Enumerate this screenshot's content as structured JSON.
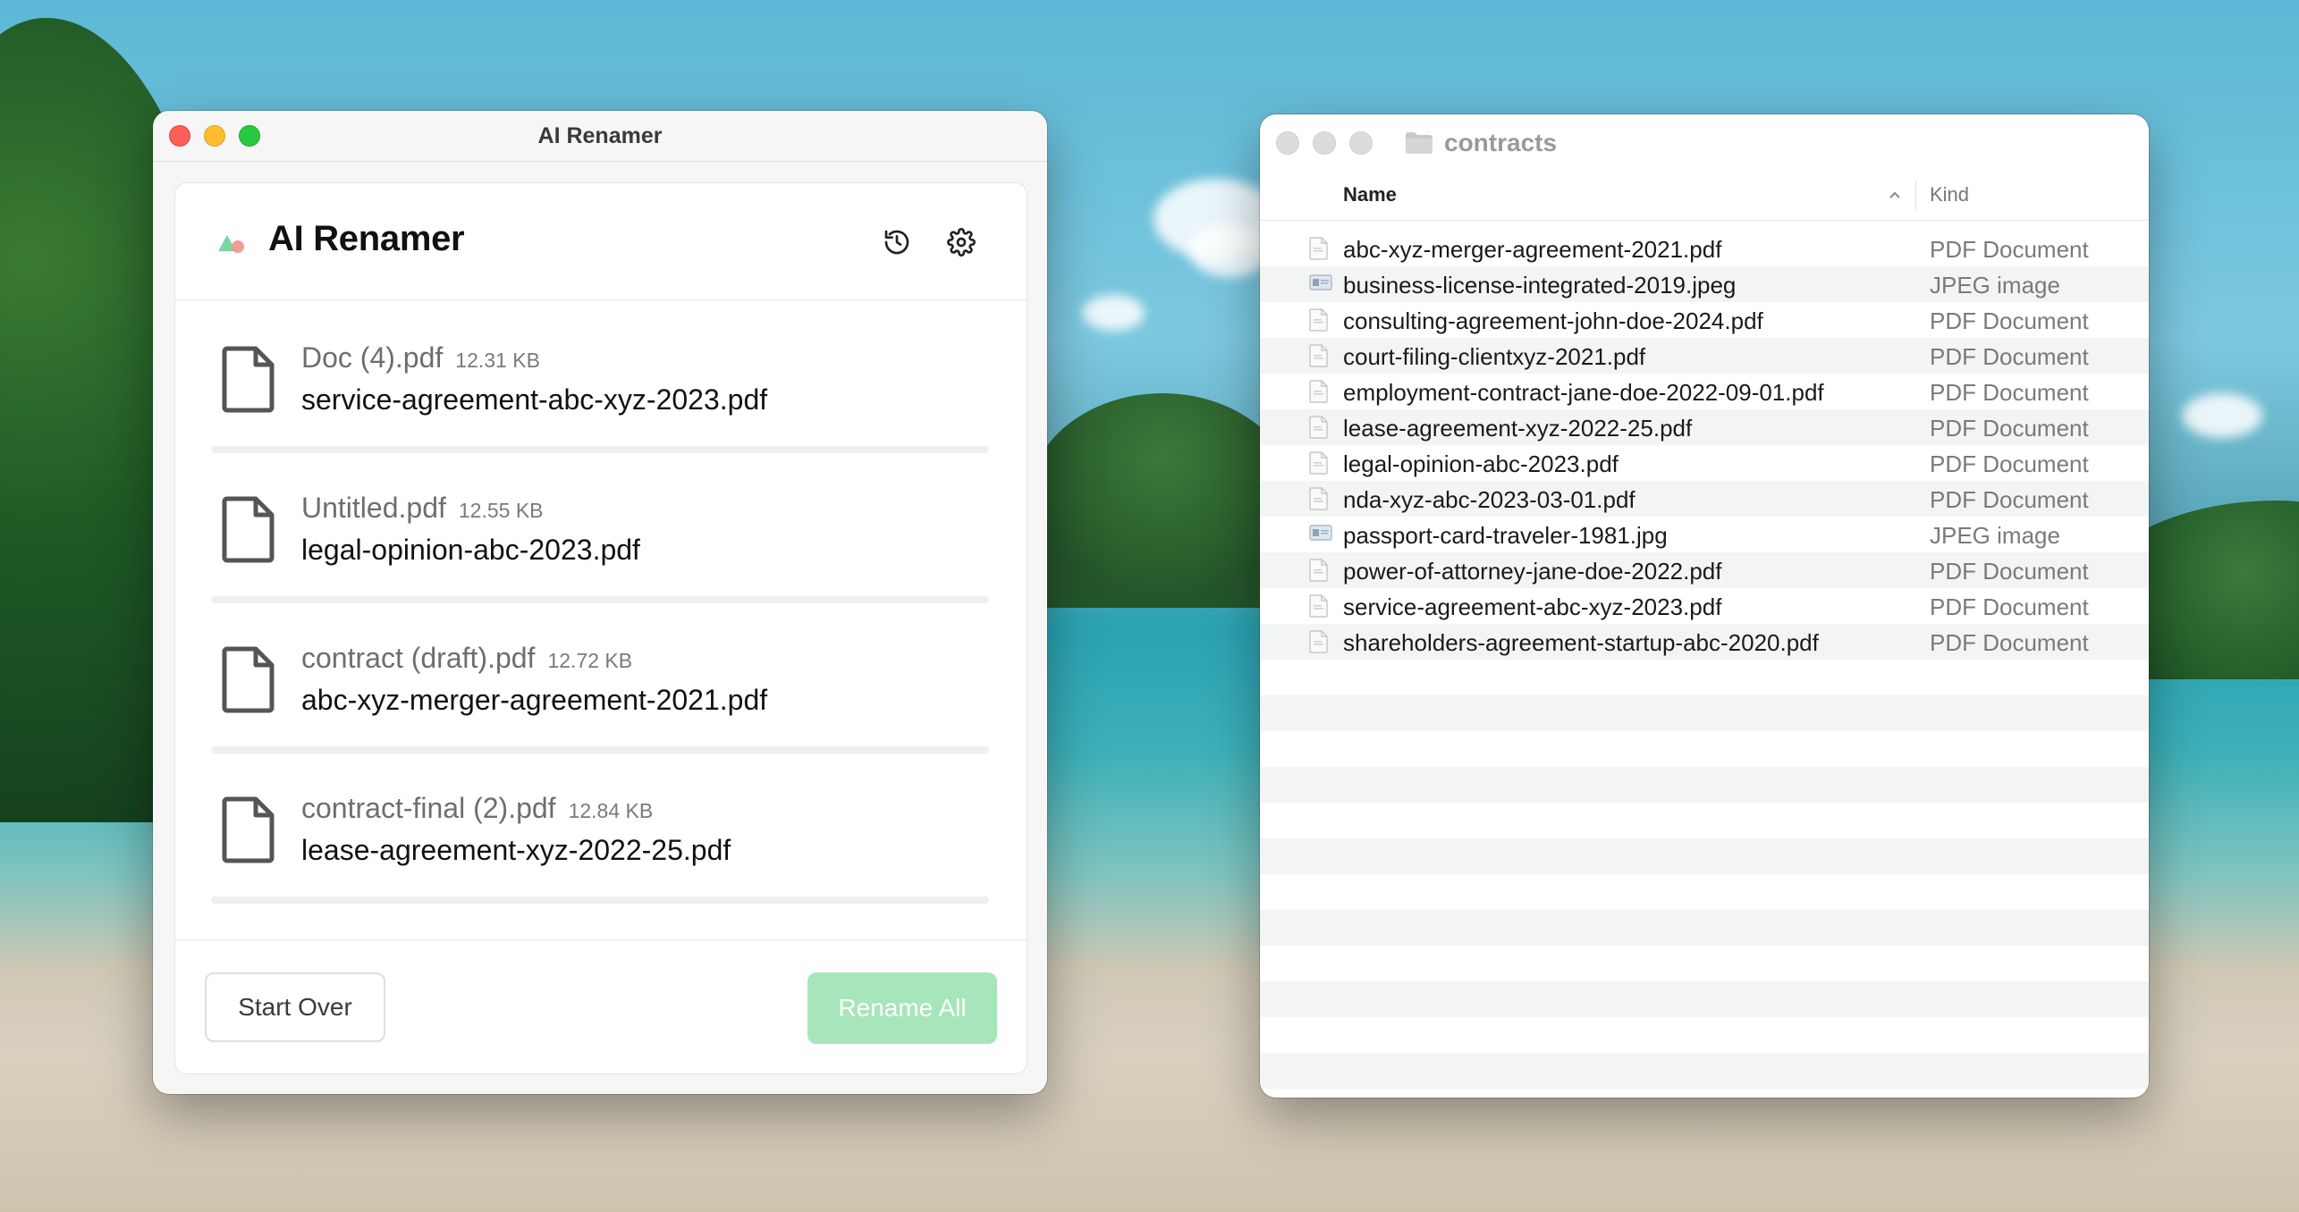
{
  "renamer": {
    "window_title": "AI Renamer",
    "app_name": "AI Renamer",
    "files": [
      {
        "original": "Doc (4).pdf",
        "size": "12.31 KB",
        "new_name": "service-agreement-abc-xyz-2023.pdf"
      },
      {
        "original": "Untitled.pdf",
        "size": "12.55 KB",
        "new_name": "legal-opinion-abc-2023.pdf"
      },
      {
        "original": "contract (draft).pdf",
        "size": "12.72 KB",
        "new_name": "abc-xyz-merger-agreement-2021.pdf"
      },
      {
        "original": "contract-final (2).pdf",
        "size": "12.84 KB",
        "new_name": "lease-agreement-xyz-2022-25.pdf"
      }
    ],
    "start_over_label": "Start Over",
    "rename_all_label": "Rename All",
    "colors": {
      "accent_green": "#a7e6bb",
      "logo_green": "#7dd6a0",
      "logo_red": "#f1948a"
    },
    "icons": [
      "history-icon",
      "gear-icon",
      "document-icon"
    ]
  },
  "finder": {
    "folder_name": "contracts",
    "columns": {
      "name": "Name",
      "kind": "Kind"
    },
    "rows": [
      {
        "name": "abc-xyz-merger-agreement-2021.pdf",
        "kind": "PDF Document",
        "icon": "pdf-file-icon"
      },
      {
        "name": "business-license-integrated-2019.jpeg",
        "kind": "JPEG image",
        "icon": "image-file-icon"
      },
      {
        "name": "consulting-agreement-john-doe-2024.pdf",
        "kind": "PDF Document",
        "icon": "pdf-file-icon"
      },
      {
        "name": "court-filing-clientxyz-2021.pdf",
        "kind": "PDF Document",
        "icon": "pdf-file-icon"
      },
      {
        "name": "employment-contract-jane-doe-2022-09-01.pdf",
        "kind": "PDF Document",
        "icon": "pdf-file-icon"
      },
      {
        "name": "lease-agreement-xyz-2022-25.pdf",
        "kind": "PDF Document",
        "icon": "pdf-file-icon"
      },
      {
        "name": "legal-opinion-abc-2023.pdf",
        "kind": "PDF Document",
        "icon": "pdf-file-icon"
      },
      {
        "name": "nda-xyz-abc-2023-03-01.pdf",
        "kind": "PDF Document",
        "icon": "pdf-file-icon"
      },
      {
        "name": "passport-card-traveler-1981.jpg",
        "kind": "JPEG image",
        "icon": "image-file-icon"
      },
      {
        "name": "power-of-attorney-jane-doe-2022.pdf",
        "kind": "PDF Document",
        "icon": "pdf-file-icon"
      },
      {
        "name": "service-agreement-abc-xyz-2023.pdf",
        "kind": "PDF Document",
        "icon": "pdf-file-icon"
      },
      {
        "name": "shareholders-agreement-startup-abc-2020.pdf",
        "kind": "PDF Document",
        "icon": "pdf-file-icon"
      }
    ],
    "empty_stripe_rows": 13
  }
}
